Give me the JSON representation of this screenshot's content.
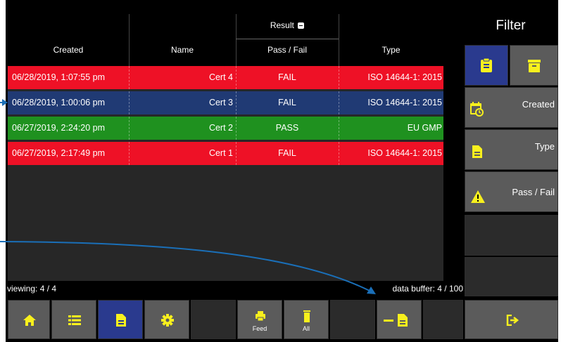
{
  "table": {
    "result_label": "Result",
    "headers": {
      "created": "Created",
      "name": "Name",
      "pass_fail": "Pass / Fail",
      "type": "Type"
    },
    "rows": [
      {
        "created": "06/28/2019, 1:07:55 pm",
        "name": "Cert 4",
        "result": "FAIL",
        "type": "ISO 14644-1: 2015",
        "color": "#ee1126"
      },
      {
        "created": "06/28/2019, 1:00:06 pm",
        "name": "Cert 3",
        "result": "FAIL",
        "type": "ISO 14644-1: 2015",
        "color": "#203a74"
      },
      {
        "created": "06/27/2019, 2:24:20 pm",
        "name": "Cert 2",
        "result": "PASS",
        "type": "EU GMP",
        "color": "#1f911f"
      },
      {
        "created": "06/27/2019, 2:17:49 pm",
        "name": "Cert 1",
        "result": "FAIL",
        "type": "ISO 14644-1: 2015",
        "color": "#ee1126"
      }
    ]
  },
  "status": {
    "viewing": "viewing: 4 / 4",
    "buffer": "data buffer: 4 / 100"
  },
  "filter": {
    "title": "Filter",
    "created": "Created",
    "type": "Type",
    "pass_fail": "Pass / Fail"
  },
  "toolbar": {
    "feed": "Feed",
    "all": "All"
  },
  "colors": {
    "accent_yellow": "#f8f01d",
    "active_blue": "#2a3a8e",
    "button_gray": "#5b5b5b",
    "panel_dark": "#2b2b2b",
    "annotation_arrow": "#1a6fb8"
  }
}
